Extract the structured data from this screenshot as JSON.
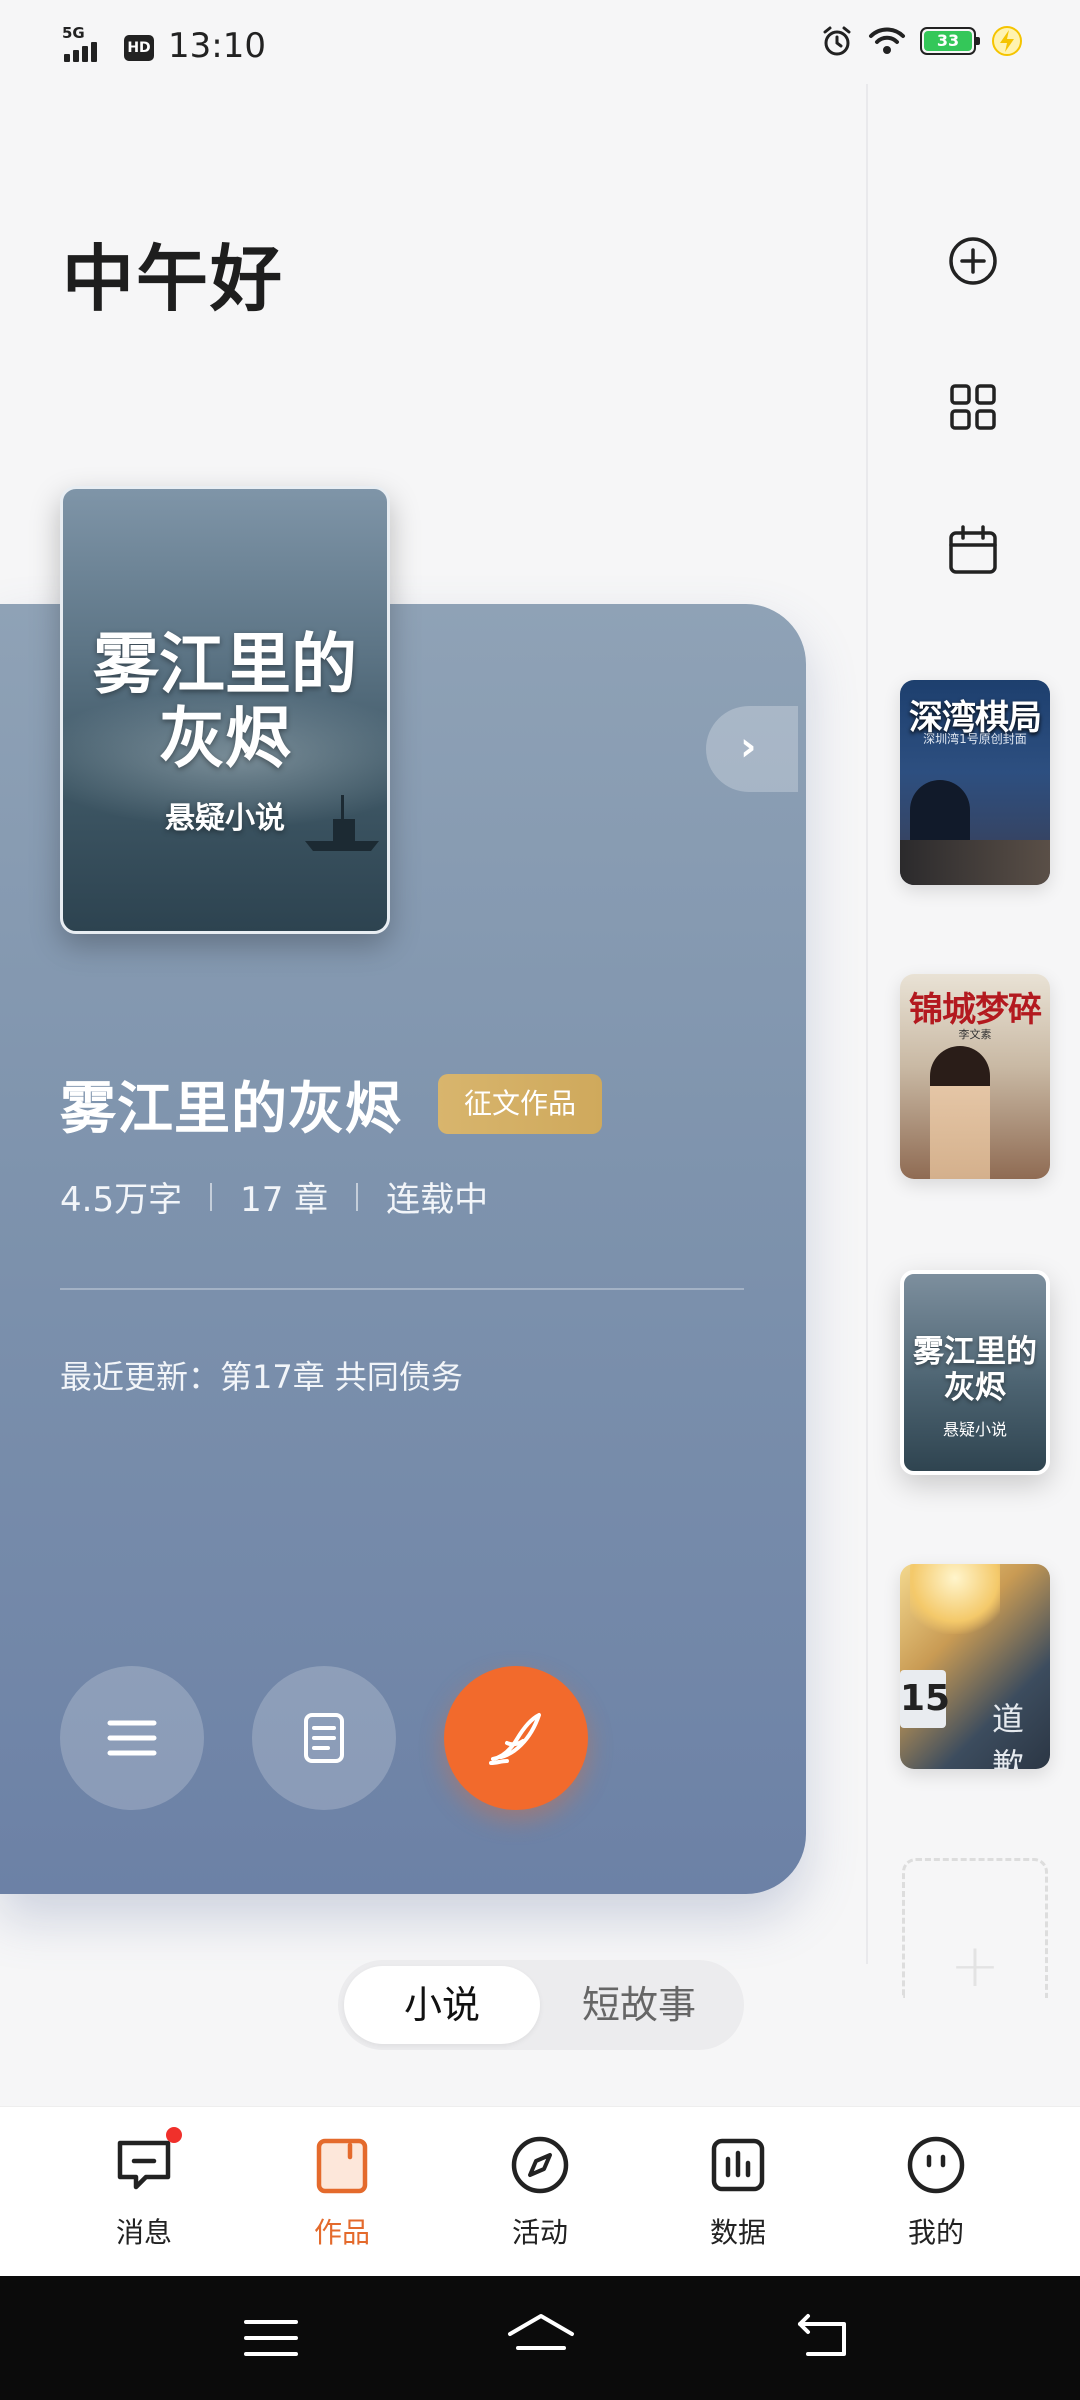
{
  "status": {
    "network": "5G",
    "hd": "HD",
    "time": "13:10",
    "battery": "33",
    "colors": {
      "battery": "#34c759",
      "charging": "#f5c400"
    },
    "icons": [
      "alarm-icon",
      "wifi-icon",
      "battery-icon",
      "charging-icon"
    ]
  },
  "greeting": "中午好",
  "sidebar": {
    "actions": [
      {
        "name": "add-icon"
      },
      {
        "name": "grid-icon"
      },
      {
        "name": "calendar-icon"
      }
    ],
    "books": [
      {
        "title": "深湾棋局",
        "subtitle": "深圳湾1号原创封面",
        "active": false
      },
      {
        "title": "锦城梦碎",
        "subtitle": "李文素",
        "active": false
      },
      {
        "title": "雾江里的灰烬",
        "subtitle": "悬疑小说",
        "active": true
      },
      {
        "title": "道歉",
        "subtitle": "15",
        "active": false
      }
    ],
    "add_symbol": "+"
  },
  "card": {
    "cover_title_line1": "雾江里的",
    "cover_title_line2": "灰烬",
    "cover_subtitle": "悬疑小说",
    "title": "雾江里的灰烬",
    "badge": "征文作品",
    "stats": [
      "4.5万字",
      "17 章",
      "连载中"
    ],
    "recent_label": "最近更新：第17章 共同债务",
    "arrow": "›",
    "buttons": [
      {
        "name": "menu-button",
        "icon": "menu-icon"
      },
      {
        "name": "document-button",
        "icon": "document-icon"
      },
      {
        "name": "write-button",
        "icon": "quill-icon"
      }
    ],
    "colors": {
      "accent": "#f26a2c",
      "badge": "#d8b56d",
      "card": "#7e93ad"
    }
  },
  "segment": {
    "options": [
      "小说",
      "短故事"
    ],
    "selected": "小说"
  },
  "bottom_nav": [
    {
      "label": "消息",
      "icon": "message-icon",
      "active": false,
      "badge": true
    },
    {
      "label": "作品",
      "icon": "works-icon",
      "active": true,
      "badge": false
    },
    {
      "label": "活动",
      "icon": "compass-icon",
      "active": false,
      "badge": false
    },
    {
      "label": "数据",
      "icon": "chart-icon",
      "active": false,
      "badge": false
    },
    {
      "label": "我的",
      "icon": "profile-icon",
      "active": false,
      "badge": false
    }
  ]
}
